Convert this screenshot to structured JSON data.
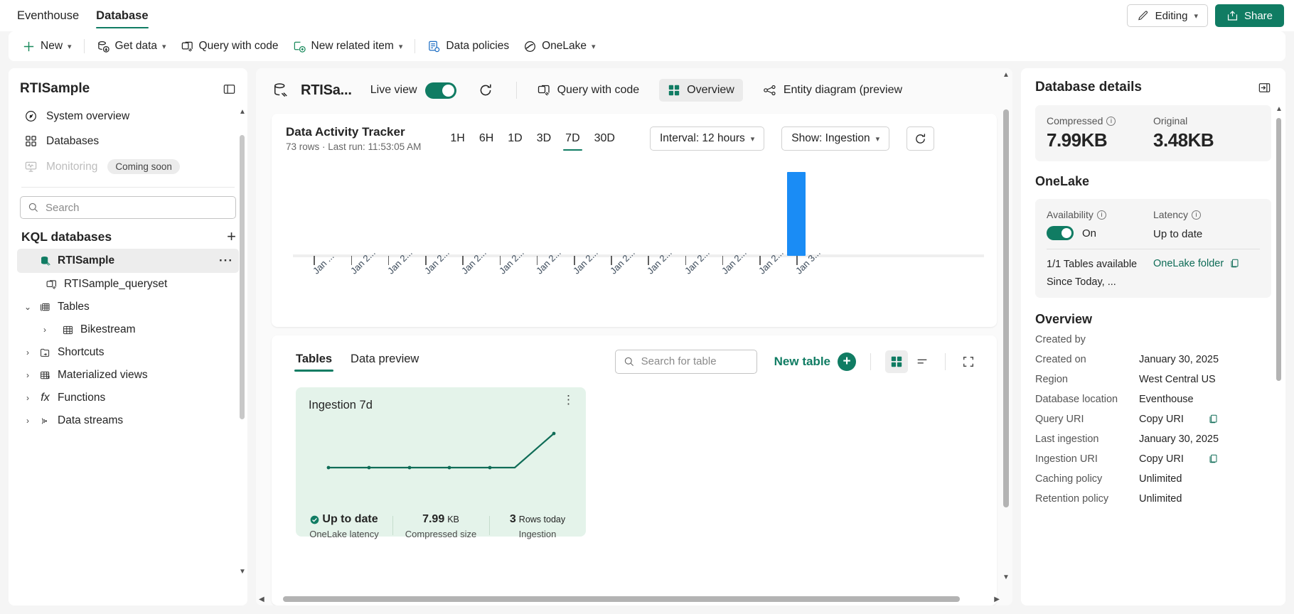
{
  "topbar": {
    "tabs": [
      {
        "label": "Eventhouse",
        "active": false
      },
      {
        "label": "Database",
        "active": true
      }
    ],
    "editing_label": "Editing",
    "share_label": "Share"
  },
  "ribbon": {
    "items": [
      {
        "label": "New",
        "icon": "plus-icon",
        "caret": true
      },
      {
        "label": "Get data",
        "icon": "get-data-icon",
        "caret": true
      },
      {
        "label": "Query with code",
        "icon": "query-code-icon",
        "caret": false
      },
      {
        "label": "New related item",
        "icon": "new-related-item-icon",
        "caret": true
      },
      {
        "label": "Data policies",
        "icon": "data-policies-icon",
        "caret": false
      },
      {
        "label": "OneLake",
        "icon": "onelake-icon",
        "caret": true
      }
    ]
  },
  "sidebar": {
    "title": "RTISample",
    "nav": [
      {
        "label": "System overview",
        "icon": "gauge-icon",
        "disabled": false
      },
      {
        "label": "Databases",
        "icon": "grid-icon",
        "disabled": false
      },
      {
        "label": "Monitoring",
        "icon": "monitor-icon",
        "disabled": true,
        "badge": "Coming soon"
      }
    ],
    "search_placeholder": "Search",
    "section_title": "KQL databases",
    "tree": [
      {
        "label": "RTISample",
        "icon": "database-icon",
        "indent": 0,
        "caret": "",
        "selected": true,
        "dots": true
      },
      {
        "label": "RTISample_queryset",
        "icon": "queryset-icon",
        "indent": 1,
        "caret": "",
        "selected": false,
        "dots": false
      },
      {
        "label": "Tables",
        "icon": "tables-icon",
        "indent": 0,
        "caret": "down",
        "selected": false,
        "dots": false
      },
      {
        "label": "Bikestream",
        "icon": "table-icon",
        "indent": 1,
        "caret": "right",
        "selected": false,
        "dots": false
      },
      {
        "label": "Shortcuts",
        "icon": "shortcuts-icon",
        "indent": 0,
        "caret": "right",
        "selected": false,
        "dots": false
      },
      {
        "label": "Materialized views",
        "icon": "materialized-views-icon",
        "indent": 0,
        "caret": "right",
        "selected": false,
        "dots": false
      },
      {
        "label": "Functions",
        "icon": "functions-icon",
        "indent": 0,
        "caret": "right",
        "selected": false,
        "dots": false
      },
      {
        "label": "Data streams",
        "icon": "data-streams-icon",
        "indent": 0,
        "caret": "right",
        "selected": false,
        "dots": false
      }
    ]
  },
  "center": {
    "db_name": "RTISa...",
    "live_view_label": "Live view",
    "live_view_on": true,
    "query_with_code_label": "Query with code",
    "overview_label": "Overview",
    "entity_diagram_label": "Entity diagram (preview",
    "tracker": {
      "title": "Data Activity Tracker",
      "subtitle": "73 rows · Last run: 11:53:05 AM",
      "ranges": [
        {
          "label": "1H",
          "active": false
        },
        {
          "label": "6H",
          "active": false
        },
        {
          "label": "1D",
          "active": false
        },
        {
          "label": "3D",
          "active": false
        },
        {
          "label": "7D",
          "active": true
        },
        {
          "label": "30D",
          "active": false
        }
      ],
      "interval_label": "Interval: 12 hours",
      "show_label": "Show: Ingestion"
    },
    "tables_section": {
      "tabs": [
        {
          "label": "Tables",
          "active": true
        },
        {
          "label": "Data preview",
          "active": false
        }
      ],
      "search_placeholder": "Search for table",
      "new_table_label": "New table",
      "tile": {
        "title": "Ingestion 7d",
        "stats": [
          {
            "value": "Up to date",
            "unit": "",
            "label": "OneLake latency",
            "check": true
          },
          {
            "value": "7.99",
            "unit": "KB",
            "label": "Compressed size",
            "check": false
          },
          {
            "value": "3",
            "unit": "Rows today",
            "label": "Ingestion",
            "check": false
          }
        ]
      }
    }
  },
  "chart_data": {
    "type": "bar",
    "title": "Data Activity Tracker",
    "subtitle": "73 rows · Last run: 11:53:05 AM",
    "xlabel": "",
    "ylabel": "",
    "grid": false,
    "legend": "none",
    "categories": [
      "Jan ...",
      "Jan 2...",
      "Jan 2...",
      "Jan 2...",
      "Jan 2...",
      "Jan 2...",
      "Jan 2...",
      "Jan 2...",
      "Jan 2...",
      "Jan 2...",
      "Jan 2...",
      "Jan 2...",
      "Jan 2...",
      "Jan 3..."
    ],
    "values": [
      0,
      0,
      0,
      0,
      0,
      0,
      0,
      0,
      0,
      0,
      0,
      0,
      0,
      3
    ],
    "ylim": [
      0,
      3
    ],
    "bar_color": "#1a8cf5",
    "series": [
      {
        "name": "Ingestion",
        "values": [
          0,
          0,
          0,
          0,
          0,
          0,
          0,
          0,
          0,
          0,
          0,
          0,
          0,
          3
        ]
      }
    ],
    "inset_chart": {
      "type": "line",
      "title": "Ingestion 7d",
      "x": [
        0,
        1,
        2,
        3,
        4,
        5,
        6
      ],
      "values": [
        0,
        0,
        0,
        0,
        0,
        0,
        3
      ],
      "line_color": "#0f6c57"
    }
  },
  "right": {
    "title": "Database details",
    "size": {
      "compressed_label": "Compressed",
      "compressed_value": "7.99KB",
      "original_label": "Original",
      "original_value": "3.48KB"
    },
    "onelake": {
      "section": "OneLake",
      "availability_label": "Availability",
      "availability_value": "On",
      "availability_on": true,
      "latency_label": "Latency",
      "latency_value": "Up to date",
      "tables_available": "1/1 Tables available",
      "since": "Since Today, ...",
      "folder_link": "OneLake folder"
    },
    "overview": {
      "section": "Overview",
      "rows": [
        {
          "key": "Created by",
          "value": "",
          "link": false
        },
        {
          "key": "Created on",
          "value": "January 30, 2025",
          "link": false
        },
        {
          "key": "Region",
          "value": "West Central US",
          "link": false
        },
        {
          "key": "Database location",
          "value": "Eventhouse",
          "link": false
        },
        {
          "key": "Query URI",
          "value": "Copy URI",
          "link": true,
          "copy": true
        },
        {
          "key": "Last ingestion",
          "value": "January 30, 2025",
          "link": false
        },
        {
          "key": "Ingestion URI",
          "value": "Copy URI",
          "link": true,
          "copy": true
        },
        {
          "key": "Caching policy",
          "value": "Unlimited",
          "link": false
        },
        {
          "key": "Retention policy",
          "value": "Unlimited",
          "link": false
        }
      ]
    }
  }
}
